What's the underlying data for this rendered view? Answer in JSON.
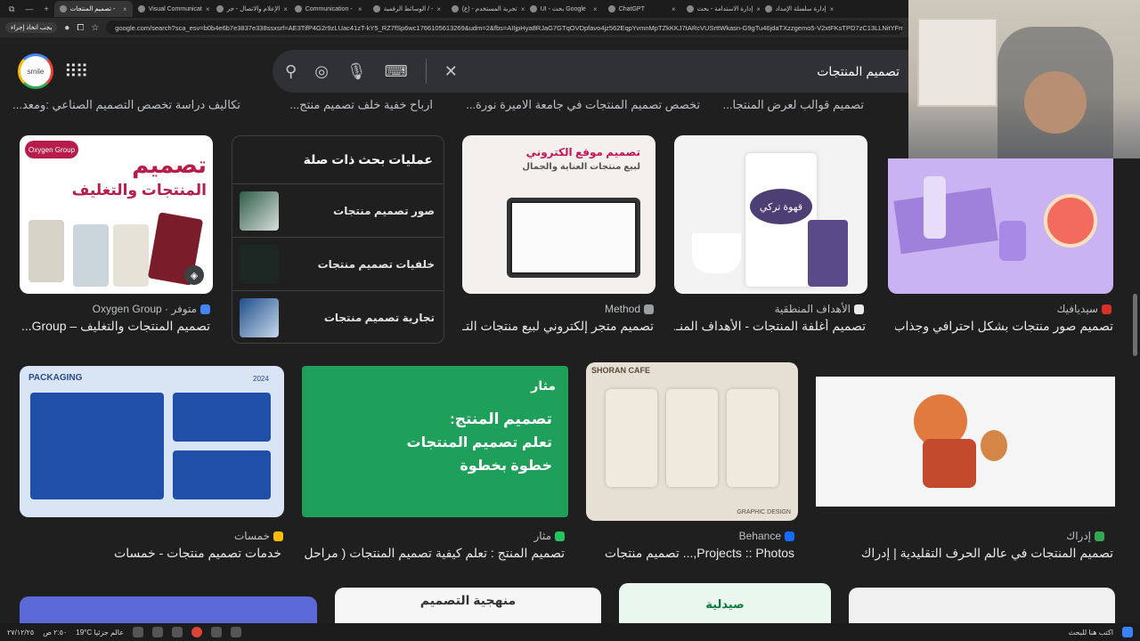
{
  "browser": {
    "tabs": [
      {
        "label": "إدارة سلسلة الإمداد"
      },
      {
        "label": "إدارة الاستدامة - بحث"
      },
      {
        "label": "ChatGPT"
      },
      {
        "label": "UI - بحث Google"
      },
      {
        "label": "تجربة المستخدم - (ع)"
      },
      {
        "label": "الوسائط الرقمية / -"
      },
      {
        "label": "Communication -"
      },
      {
        "label": "الإعلام والاتصال - جر"
      },
      {
        "label": "Visual Communicat"
      },
      {
        "label": "تصميم المنتجات -"
      }
    ],
    "url": "google.com/search?sca_esv=b0b4e6b7e3837e338ssxsrf=AE3TifP4G2r9zLUac41zT-kY5_RZ7fSp6wc1766105613269&udm=2&fbs=AIIjpHya8RJaG7GTqOVDpfavo4jz562EqpYvmnMpTZkKKJ7tARcVUSrttWkasn-G9gTu46jdaTXzzgemo5-V2xtFKsTPD7zC13LLNitYFmF",
    "update_label": "يجب اتخاذ إجراء"
  },
  "search": {
    "query": "تصميم المنتجات",
    "avatar_label": "smile"
  },
  "cut_titles": [
    "تصميم قوالب لعرض المنتجا...",
    "تخصص تصميم المنتجات في جامعة الاميرة نورة...",
    "ارباح خفية خلف تصميم منتج...",
    "تكاليف دراسة تخصص التصميم الصناعي :ومعد..."
  ],
  "related": {
    "heading": "عمليات بحث ذات صلة",
    "items": [
      {
        "label": "صور تصميم منتجات"
      },
      {
        "label": "خلفيات تصميم منتجات"
      },
      {
        "label": "تجارية تصميم منتجات"
      }
    ]
  },
  "results_row1": [
    {
      "source": "سيديافيك",
      "title": "تصميم صور منتجات بشكل احترافي وجذاب ...",
      "fav_color": "#d93025"
    },
    {
      "source": "الأهداف المنطقية",
      "title": "تصميم أغلفة المنتجات - الأهداف المنـ...",
      "fav_color": "#e8eaed"
    },
    {
      "source": "Method",
      "title": "تصميم متجر إلكتروني لبيع منتجات التـ...",
      "fav_color": "#9aa0a6"
    },
    {
      "source": "متوفر · Oxygen Group",
      "title": "تصميم المنتجات والتغليف – Group...",
      "fav_color": "#4285f4"
    }
  ],
  "thumb_texts": {
    "coffee_bag": "قهوة تركي",
    "method_top": "تصميم موقع الكتروني",
    "method_sub": "لبيع منتجات العناية والجمال",
    "oxygen_logo": "Oxygen Group",
    "oxygen_title": "تصميم",
    "oxygen_sub": "المنتجات والتغليف",
    "packaging_label": "PACKAGING",
    "packaging_year": "2024",
    "mathar_title": "تصميم المنتج:",
    "mathar_sub1": "تعلم تصميم المنتجات",
    "mathar_sub2": "خطوة بخطوة",
    "mathar_logo": "مثار",
    "shoran_brand": "SHORAN CAFE",
    "design_label": "GRAPHIC DESIGN",
    "bottom1": "منهجية التصميم",
    "bottom2": "صيدلية"
  },
  "results_row2": [
    {
      "source": "إدراك",
      "title": "تصميم المنتجات في عالم الحرف التقليدية | إدراك",
      "fav_color": "#34a853"
    },
    {
      "source": "Behance",
      "title": "Projects :: Photos,... تصميم منتجات",
      "fav_color": "#1769ff"
    },
    {
      "source": "مثار",
      "title": "تصميم المنتج : تعلم كيفية تصميم المنتجات ( مراحل ت...",
      "fav_color": "#22c55e"
    },
    {
      "source": "خمسات",
      "title": "خدمات تصميم منتجات - خمسات",
      "fav_color": "#fbbc05"
    }
  ],
  "taskbar": {
    "weather": "19°C عالم جزئيا",
    "search_placeholder": "اكتب هنا للبحث",
    "time": "٢:٥٠ ص",
    "date": "٢٧/١٢/٢٥"
  }
}
